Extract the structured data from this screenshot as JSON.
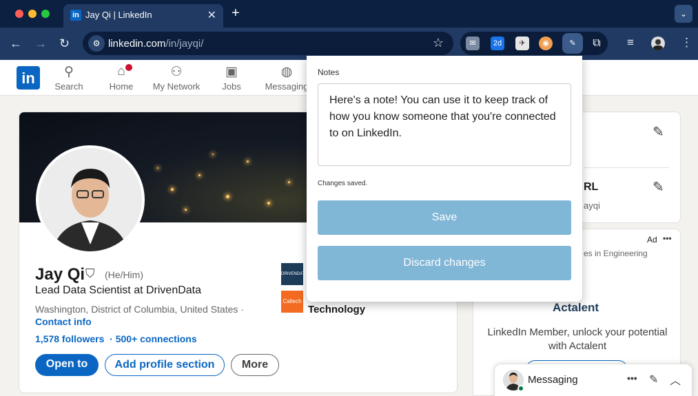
{
  "browser": {
    "tab_title": "Jay Qi | LinkedIn",
    "tab_favicon": "in",
    "url_host": "linkedin.com",
    "url_path": "/in/jayqi/",
    "calendar_badge": "2d"
  },
  "linkedin_nav": {
    "logo": "in",
    "items": [
      {
        "label": "Search",
        "icon": "search-icon"
      },
      {
        "label": "Home",
        "icon": "home-icon"
      },
      {
        "label": "My Network",
        "icon": "network-icon"
      },
      {
        "label": "Jobs",
        "icon": "briefcase-icon"
      },
      {
        "label": "Messaging",
        "icon": "chat-icon"
      }
    ]
  },
  "profile": {
    "name": "Jay Qi",
    "pronouns": "(He/Him)",
    "headline": "Lead Data Scientist at DrivenData",
    "location": "Washington, District of Columbia, United States ·",
    "contact_info": "Contact info",
    "followers": "1,578 followers",
    "connections": "· 500+ connections",
    "buttons": {
      "open_to": "Open to",
      "add_section": "Add profile section",
      "more": "More"
    },
    "companies": [
      {
        "logo_text": "DRIVENDATA",
        "color": "#1e3c5a"
      },
      {
        "logo_text": "Caltech",
        "color": "#f26b21",
        "name_fragment": "Technology"
      }
    ]
  },
  "right_column": {
    "url_fragment": "RL",
    "url_sub": "ayqi",
    "ad_label": "Ad",
    "ad_more": "•••",
    "ad_tagline": "es in Engineering",
    "ad_brand": "Actalent",
    "ad_text": "LinkedIn Member, unlock your potential with Actalent"
  },
  "messaging": {
    "label": "Messaging"
  },
  "notes_popup": {
    "label": "Notes",
    "note_text": "Here's a note! You can use it to keep track of how you know someone that you're connected to on LinkedIn.",
    "status": "Changes saved.",
    "save_label": "Save",
    "discard_label": "Discard changes",
    "button_color": "#80b6d6"
  },
  "colors": {
    "linkedin_blue": "#0a66c2",
    "chrome_dark": "#0c2142",
    "chrome_toolbar": "#203a63"
  }
}
